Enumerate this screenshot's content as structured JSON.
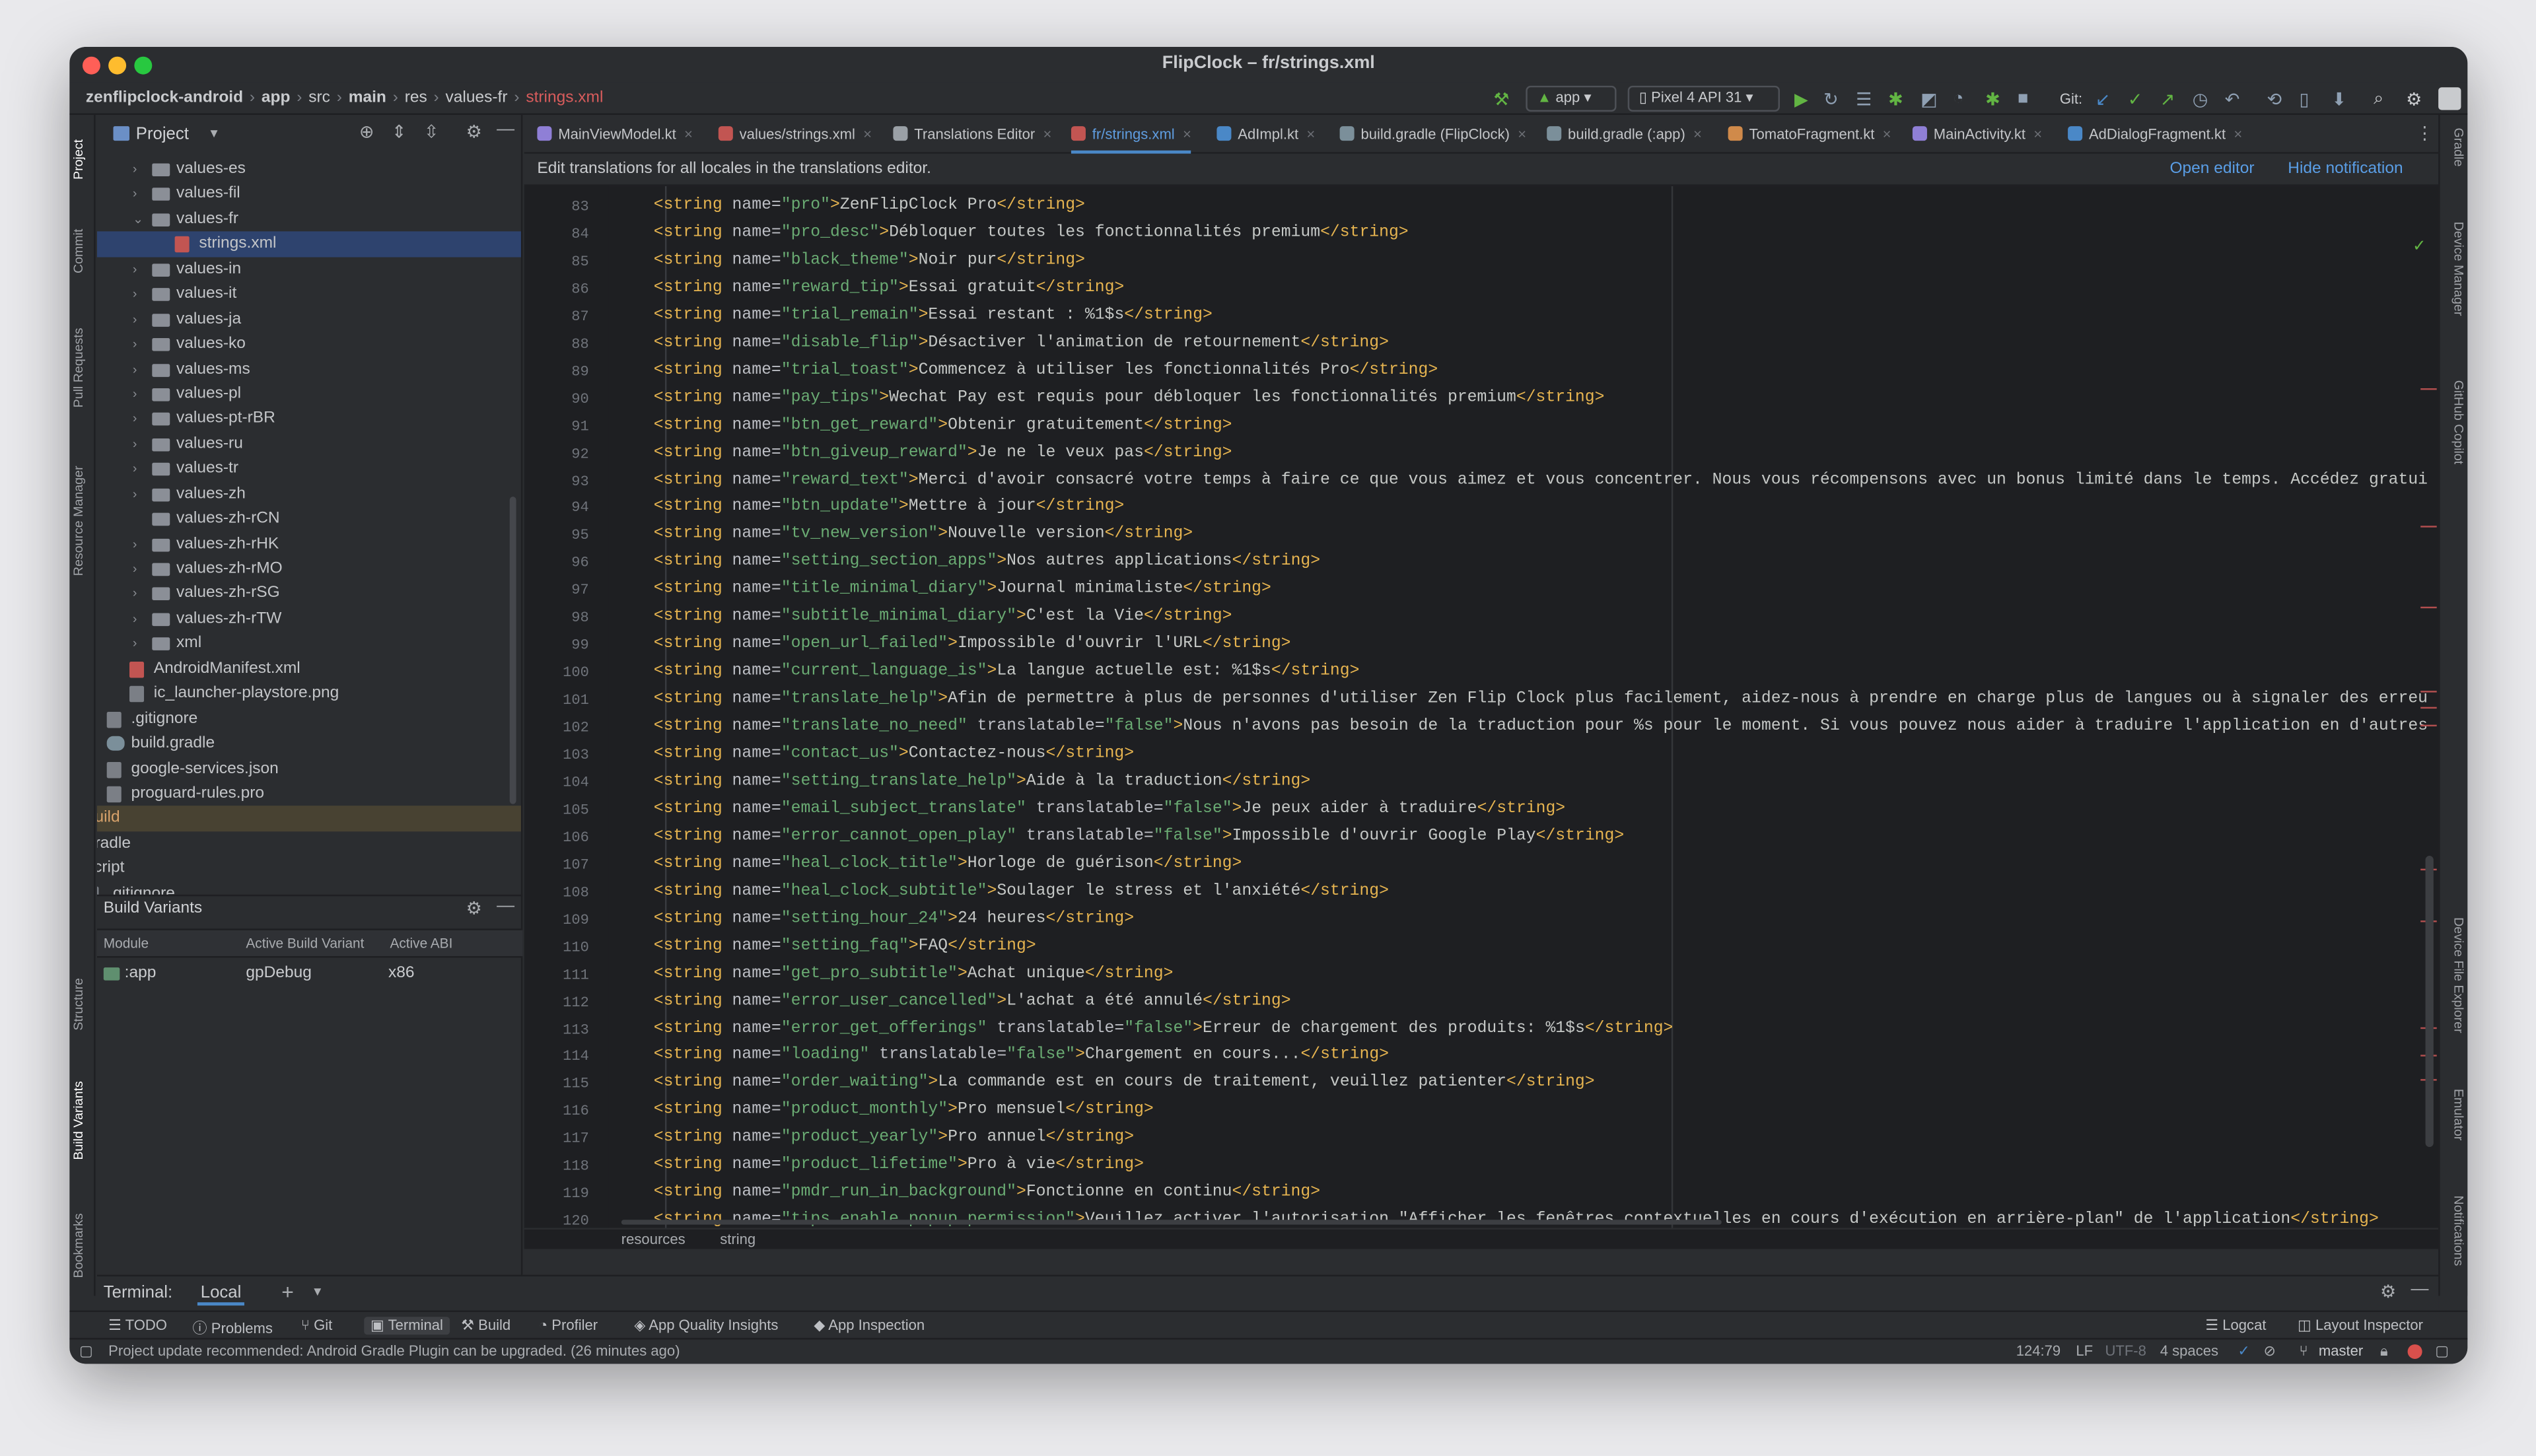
{
  "window": {
    "title": "FlipClock – fr/strings.xml"
  },
  "breadcrumb": [
    "zenflipclock-android",
    "app",
    "src",
    "main",
    "res",
    "values-fr",
    "strings.xml"
  ],
  "toolbar": {
    "run_config": "app",
    "device": "Pixel 4 API 31",
    "git_label": "Git:"
  },
  "project_panel": {
    "title": "Project",
    "tree": [
      {
        "label": "values-es",
        "type": "folder",
        "indent": 5,
        "chev": "›"
      },
      {
        "label": "values-fil",
        "type": "folder",
        "indent": 5,
        "chev": "›"
      },
      {
        "label": "values-fr",
        "type": "folder",
        "indent": 5,
        "chev": "⌄"
      },
      {
        "label": "strings.xml",
        "type": "xml",
        "indent": 6,
        "chev": "",
        "selected": true
      },
      {
        "label": "values-in",
        "type": "folder",
        "indent": 5,
        "chev": "›"
      },
      {
        "label": "values-it",
        "type": "folder",
        "indent": 5,
        "chev": "›"
      },
      {
        "label": "values-ja",
        "type": "folder",
        "indent": 5,
        "chev": "›"
      },
      {
        "label": "values-ko",
        "type": "folder",
        "indent": 5,
        "chev": "›"
      },
      {
        "label": "values-ms",
        "type": "folder",
        "indent": 5,
        "chev": "›"
      },
      {
        "label": "values-pl",
        "type": "folder",
        "indent": 5,
        "chev": "›"
      },
      {
        "label": "values-pt-rBR",
        "type": "folder",
        "indent": 5,
        "chev": "›"
      },
      {
        "label": "values-ru",
        "type": "folder",
        "indent": 5,
        "chev": "›"
      },
      {
        "label": "values-tr",
        "type": "folder",
        "indent": 5,
        "chev": "›"
      },
      {
        "label": "values-zh",
        "type": "folder",
        "indent": 5,
        "chev": "›"
      },
      {
        "label": "values-zh-rCN",
        "type": "folder",
        "indent": 5,
        "chev": ""
      },
      {
        "label": "values-zh-rHK",
        "type": "folder",
        "indent": 5,
        "chev": "›"
      },
      {
        "label": "values-zh-rMO",
        "type": "folder",
        "indent": 5,
        "chev": "›"
      },
      {
        "label": "values-zh-rSG",
        "type": "folder",
        "indent": 5,
        "chev": "›"
      },
      {
        "label": "values-zh-rTW",
        "type": "folder",
        "indent": 5,
        "chev": "›"
      },
      {
        "label": "xml",
        "type": "folder",
        "indent": 5,
        "chev": "›"
      },
      {
        "label": "AndroidManifest.xml",
        "type": "xml",
        "indent": 4,
        "chev": ""
      },
      {
        "label": "ic_launcher-playstore.png",
        "type": "file",
        "indent": 4,
        "chev": ""
      },
      {
        "label": ".gitignore",
        "type": "file",
        "indent": 3,
        "chev": ""
      },
      {
        "label": "build.gradle",
        "type": "gradle",
        "indent": 3,
        "chev": ""
      },
      {
        "label": "google-services.json",
        "type": "file",
        "indent": 3,
        "chev": ""
      },
      {
        "label": "proguard-rules.pro",
        "type": "file",
        "indent": 3,
        "chev": ""
      },
      {
        "label": "build",
        "type": "redfolder",
        "indent": 1,
        "chev": "›",
        "build": true
      },
      {
        "label": "gradle",
        "type": "folder",
        "indent": 1,
        "chev": "›"
      },
      {
        "label": "script",
        "type": "folder",
        "indent": 1,
        "chev": "›"
      },
      {
        "label": ".gitignore",
        "type": "file",
        "indent": 2,
        "chev": ""
      }
    ]
  },
  "build_variants": {
    "title": "Build Variants",
    "columns": [
      "Module",
      "Active Build Variant",
      "Active ABI"
    ],
    "row": [
      ":app",
      "gpDebug",
      "x86"
    ]
  },
  "left_tool_labels": [
    "Project",
    "Commit",
    "Pull Requests",
    "Resource Manager",
    "Structure",
    "Build Variants",
    "Bookmarks"
  ],
  "right_tool_labels": [
    "Gradle",
    "Device Manager",
    "GitHub Copilot",
    "Device File Explorer",
    "Emulator",
    "Notifications"
  ],
  "tabs": [
    {
      "label": "MainViewModel.kt",
      "color": "#8f7fd6"
    },
    {
      "label": "values/strings.xml",
      "color": "#c25552"
    },
    {
      "label": "Translations Editor",
      "color": "#9aa0a6"
    },
    {
      "label": "fr/strings.xml",
      "color": "#c25552",
      "active": true
    },
    {
      "label": "AdImpl.kt",
      "color": "#4a88c7"
    },
    {
      "label": "build.gradle (FlipClock)",
      "color": "#7b8f9a"
    },
    {
      "label": "build.gradle (:app)",
      "color": "#7b8f9a"
    },
    {
      "label": "TomatoFragment.kt",
      "color": "#d08a4a"
    },
    {
      "label": "MainActivity.kt",
      "color": "#8f7fd6"
    },
    {
      "label": "AdDialogFragment.kt",
      "color": "#4a88c7"
    }
  ],
  "notification": {
    "message": "Edit translations for all locales in the translations editor.",
    "open_editor": "Open editor",
    "hide": "Hide notification"
  },
  "code_lines": [
    {
      "n": "83",
      "name": "pro",
      "text": "ZenFlipClock Pro"
    },
    {
      "n": "84",
      "name": "pro_desc",
      "text": "Débloquer toutes les fonctionnalités premium"
    },
    {
      "n": "85",
      "name": "black_theme",
      "text": "Noir pur"
    },
    {
      "n": "86",
      "name": "reward_tip",
      "text": "Essai gratuit"
    },
    {
      "n": "87",
      "name": "trial_remain",
      "text": "Essai restant : %1$s"
    },
    {
      "n": "88",
      "name": "disable_flip",
      "text": "Désactiver l'animation de retournement"
    },
    {
      "n": "89",
      "name": "trial_toast",
      "text": "Commencez à utiliser les fonctionnalités Pro"
    },
    {
      "n": "90",
      "name": "pay_tips",
      "text": "Wechat Pay est requis pour débloquer les fonctionnalités premium"
    },
    {
      "n": "91",
      "name": "btn_get_reward",
      "text": "Obtenir gratuitement"
    },
    {
      "n": "92",
      "name": "btn_giveup_reward",
      "text": "Je ne le veux pas"
    },
    {
      "n": "93",
      "name": "reward_text",
      "text": "Merci d'avoir consacré votre temps à faire ce que vous aimez et vous concentrer. Nous vous récompensons avec un bonus limité dans le temps. Accédez gratuitement",
      "open": true
    },
    {
      "n": "94",
      "name": "btn_update",
      "text": "Mettre à jour"
    },
    {
      "n": "95",
      "name": "tv_new_version",
      "text": "Nouvelle version"
    },
    {
      "n": "96",
      "name": "setting_section_apps",
      "text": "Nos autres applications"
    },
    {
      "n": "97",
      "name": "title_minimal_diary",
      "text": "Journal minimaliste"
    },
    {
      "n": "98",
      "name": "subtitle_minimal_diary",
      "text": "C'est la Vie"
    },
    {
      "n": "99",
      "name": "open_url_failed",
      "text": "Impossible d'ouvrir l'URL"
    },
    {
      "n": "100",
      "name": "current_language_is",
      "text": "La langue actuelle est: %1$s"
    },
    {
      "n": "101",
      "name": "translate_help",
      "text": "Afin de permettre à plus de personnes d'utiliser Zen Flip Clock plus facilement, aidez-nous à prendre en charge plus de langues ou à signaler des erreurs",
      "open": true
    },
    {
      "n": "102",
      "name": "translate_no_need",
      "attr": "translatable",
      "attrv": "false",
      "text": "Nous n'avons pas besoin de la traduction pour %s pour le moment. Si vous pouvez nous aider à traduire l'application en d'autres la",
      "open": true
    },
    {
      "n": "103",
      "name": "contact_us",
      "text": "Contactez-nous"
    },
    {
      "n": "104",
      "name": "setting_translate_help",
      "text": "Aide à la traduction"
    },
    {
      "n": "105",
      "name": "email_subject_translate",
      "attr": "translatable",
      "attrv": "false",
      "text": "Je peux aider à traduire"
    },
    {
      "n": "106",
      "name": "error_cannot_open_play",
      "attr": "translatable",
      "attrv": "false",
      "text": "Impossible d'ouvrir Google Play"
    },
    {
      "n": "107",
      "name": "heal_clock_title",
      "text": "Horloge de guérison"
    },
    {
      "n": "108",
      "name": "heal_clock_subtitle",
      "text": "Soulager le stress et l'anxiété"
    },
    {
      "n": "109",
      "name": "setting_hour_24",
      "text": "24 heures"
    },
    {
      "n": "110",
      "name": "setting_faq",
      "text": "FAQ"
    },
    {
      "n": "111",
      "name": "get_pro_subtitle",
      "text": "Achat unique"
    },
    {
      "n": "112",
      "name": "error_user_cancelled",
      "text": "L'achat a été annulé"
    },
    {
      "n": "113",
      "name": "error_get_offerings",
      "attr": "translatable",
      "attrv": "false",
      "text": "Erreur de chargement des produits: %1$s"
    },
    {
      "n": "114",
      "name": "loading",
      "attr": "translatable",
      "attrv": "false",
      "text": "Chargement en cours..."
    },
    {
      "n": "115",
      "name": "order_waiting",
      "text": "La commande est en cours de traitement, veuillez patienter"
    },
    {
      "n": "116",
      "name": "product_monthly",
      "text": "Pro mensuel"
    },
    {
      "n": "117",
      "name": "product_yearly",
      "text": "Pro annuel"
    },
    {
      "n": "118",
      "name": "product_lifetime",
      "text": "Pro à vie"
    },
    {
      "n": "119",
      "name": "pmdr_run_in_background",
      "text": "Fonctionne en continu"
    },
    {
      "n": "120",
      "name": "tips_enable_popup_permission",
      "text": "Veuillez activer l'autorisation \"Afficher les fenêtres contextuelles en cours d'exécution en arrière-plan\" de l'application"
    }
  ],
  "editor_breadcrumb": [
    "resources",
    "string"
  ],
  "terminal": {
    "label": "Terminal:",
    "tab": "Local"
  },
  "bottom_tools": [
    "TODO",
    "Problems",
    "Git",
    "Terminal",
    "Build",
    "Profiler",
    "App Quality Insights",
    "App Inspection"
  ],
  "bottom_tools_right": [
    "Logcat",
    "Layout Inspector"
  ],
  "status": {
    "message": "Project update recommended: Android Gradle Plugin can be upgraded. (26 minutes ago)",
    "position": "124:79",
    "line_sep": "LF",
    "encoding": "UTF-8",
    "indent": "4 spaces",
    "branch": "master"
  }
}
